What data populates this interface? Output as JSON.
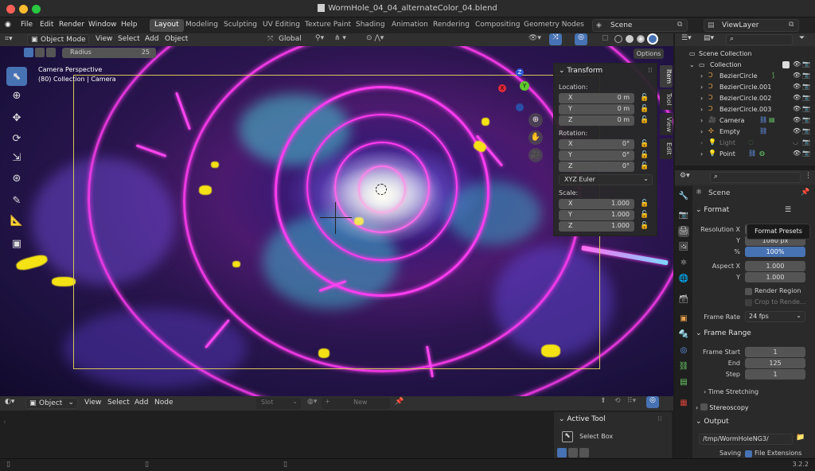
{
  "window": {
    "title": "WormHole_04_04_alternateColor_04.blend"
  },
  "menu": [
    "File",
    "Edit",
    "Render",
    "Window",
    "Help"
  ],
  "workspaces": [
    "Layout",
    "Modeling",
    "Sculpting",
    "UV Editing",
    "Texture Paint",
    "Shading",
    "Animation",
    "Rendering",
    "Compositing",
    "Geometry Nodes"
  ],
  "scene_field": "Scene",
  "viewlayer_field": "ViewLayer",
  "viewport_header": {
    "mode": "Object Mode",
    "menus": [
      "View",
      "Select",
      "Add",
      "Object"
    ],
    "transform": "Global"
  },
  "tool_settings": {
    "radius_label": "Radius",
    "radius_value": "25",
    "options": "Options"
  },
  "viewport_info": {
    "line1": "Camera Perspective",
    "line2": "(80) Collection | Camera"
  },
  "sidebar_tabs": [
    "Item",
    "Tool",
    "View",
    "Edit"
  ],
  "transform_panel": {
    "title": "Transform",
    "location_label": "Location:",
    "location": [
      {
        "k": "X",
        "v": "0 m"
      },
      {
        "k": "Y",
        "v": "0 m"
      },
      {
        "k": "Z",
        "v": "0 m"
      }
    ],
    "rotation_label": "Rotation:",
    "rotation": [
      {
        "k": "X",
        "v": "0°"
      },
      {
        "k": "Y",
        "v": "0°"
      },
      {
        "k": "Z",
        "v": "0°"
      }
    ],
    "rotation_mode": "XYZ Euler",
    "scale_label": "Scale:",
    "scale": [
      {
        "k": "X",
        "v": "1.000"
      },
      {
        "k": "Y",
        "v": "1.000"
      },
      {
        "k": "Z",
        "v": "1.000"
      }
    ]
  },
  "gizmo": {
    "x": "X",
    "y": "Y",
    "z": "Z"
  },
  "outliner": {
    "scene_collection": "Scene Collection",
    "collection": "Collection",
    "items": [
      "BezierCircle",
      "BezierCircle.001",
      "BezierCircle.002",
      "BezierCircle.003",
      "Camera",
      "Empty",
      "Light",
      "Point"
    ]
  },
  "properties": {
    "scene_label": "Scene",
    "format_title": "Format",
    "format_presets_tooltip": "Format Presets",
    "res_x_label": "Resolution X",
    "res_y_label": "Y",
    "res_y_value": "1080 px",
    "res_pct_label": "%",
    "res_pct_value": "100%",
    "aspect_x_label": "Aspect X",
    "aspect_x_value": "1.000",
    "aspect_y_label": "Y",
    "aspect_y_value": "1.000",
    "render_region": "Render Region",
    "crop": "Crop to Rende...",
    "frame_rate_label": "Frame Rate",
    "frame_rate_value": "24 fps",
    "frame_range_title": "Frame Range",
    "frame_start_label": "Frame Start",
    "frame_start_value": "1",
    "end_label": "End",
    "end_value": "125",
    "step_label": "Step",
    "step_value": "1",
    "time_stretching": "Time Stretching",
    "stereoscopy": "Stereoscopy",
    "output_title": "Output",
    "output_path": "/tmp/WormHoleNG3/",
    "saving_label": "Saving",
    "file_extensions": "File Extensions"
  },
  "shader_header": {
    "mode": "Object",
    "menus": [
      "View",
      "Select",
      "Add",
      "Node"
    ],
    "slot": "Slot",
    "new": "New"
  },
  "active_tool": {
    "title": "Active Tool",
    "tool": "Select Box"
  },
  "version": "3.2.2",
  "colors": {
    "accent": "#4772b3",
    "neon_pink": "#ff3cf0",
    "neon_yellow": "#f4e214",
    "cyan": "#39c8d8"
  }
}
